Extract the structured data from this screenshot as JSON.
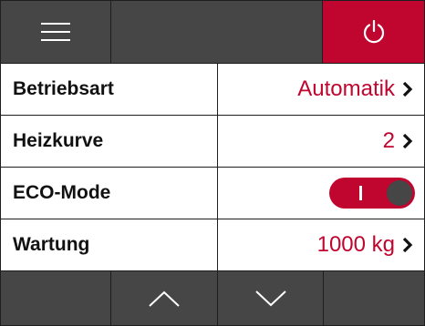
{
  "topbar": {
    "menu_icon": "hamburger-menu-icon",
    "power_icon": "power-icon",
    "power_color": "#c0052f"
  },
  "rows": [
    {
      "label": "Betriebsart",
      "value": "Automatik",
      "icon": "chevron-right-icon"
    },
    {
      "label": "Heizkurve",
      "value": "2",
      "icon": "chevron-right-icon"
    },
    {
      "label": "ECO-Mode",
      "toggle": {
        "state": "on",
        "icon": "toggle-switch"
      }
    },
    {
      "label": "Wartung",
      "value": "1000 kg",
      "icon": "chevron-right-icon"
    }
  ],
  "bottombar": {
    "up_icon": "chevron-up-icon",
    "down_icon": "chevron-down-icon"
  },
  "colors": {
    "accent": "#c0052f",
    "bar_background": "#464646",
    "divider": "#1e1e1e"
  }
}
